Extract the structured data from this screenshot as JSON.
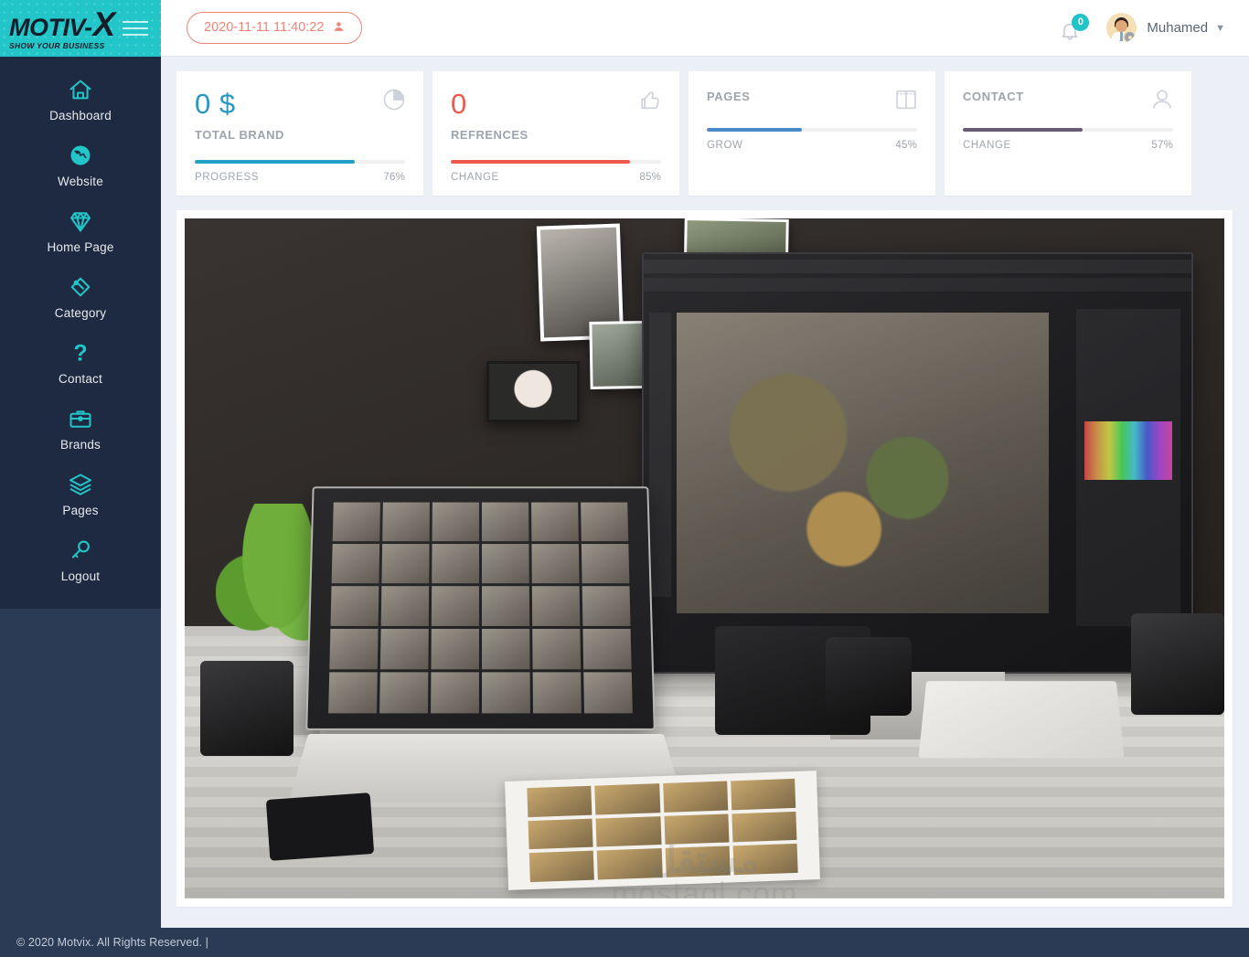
{
  "brand": {
    "logo_main": "MOTIV-",
    "logo_main_accent": "X",
    "logo_tagline": "SHOW YOUR BUSINESS",
    "accent_teal": "#23c6c8",
    "sidebar_bg": "#1e2a42",
    "sidebar_outer_bg": "#2b3a55"
  },
  "sidebar": {
    "items": [
      {
        "label": "Dashboard",
        "icon": "home-icon"
      },
      {
        "label": "Website",
        "icon": "globe-icon"
      },
      {
        "label": "Home Page",
        "icon": "diamond-icon"
      },
      {
        "label": "Category",
        "icon": "tag-icon"
      },
      {
        "label": "Contact",
        "icon": "question-mark-icon"
      },
      {
        "label": "Brands",
        "icon": "briefcase-icon"
      },
      {
        "label": "Pages",
        "icon": "layers-icon"
      },
      {
        "label": "Logout",
        "icon": "key-icon"
      }
    ]
  },
  "header": {
    "datetime_badge": "2020-11-11 11:40:22",
    "datetime_badge_color": "#ef8377",
    "notification_count": "0",
    "notification_badge_color": "#21c3c6",
    "user_name": "Muhamed",
    "chevron": "⌄"
  },
  "cards": [
    {
      "value": "0 $",
      "value_color": "#2898c0",
      "subtitle": "TOTAL BRAND",
      "icon": "pie-chart-icon",
      "bar_label": "PROGRESS",
      "bar_percent": "76%",
      "bar_value": 76,
      "bar_color": "#23a0c4"
    },
    {
      "value": "0",
      "value_color": "#ed5a4d",
      "subtitle": "REFRENCES",
      "icon": "thumbs-up-icon",
      "bar_label": "CHANGE",
      "bar_percent": "85%",
      "bar_value": 85,
      "bar_color": "#ed5a4d"
    },
    {
      "title": "PAGES",
      "icon": "columns-icon",
      "bar_label": "GROW",
      "bar_percent": "45%",
      "bar_value": 45,
      "bar_color": "#4a89c8"
    },
    {
      "title": "CONTACT",
      "icon": "user-outline-icon",
      "bar_label": "CHANGE",
      "bar_percent": "57%",
      "bar_value": 57,
      "bar_color": "#6b5b72"
    }
  ],
  "content": {
    "hero_image_alt": "photography workspace with desktop computer, laptop, cameras and printed photos",
    "watermark_arabic": "مستقل",
    "watermark_latin": "mostaql.com"
  },
  "footer": {
    "copyright": "© 2020 Motvix. All Rights Reserved.  |"
  }
}
